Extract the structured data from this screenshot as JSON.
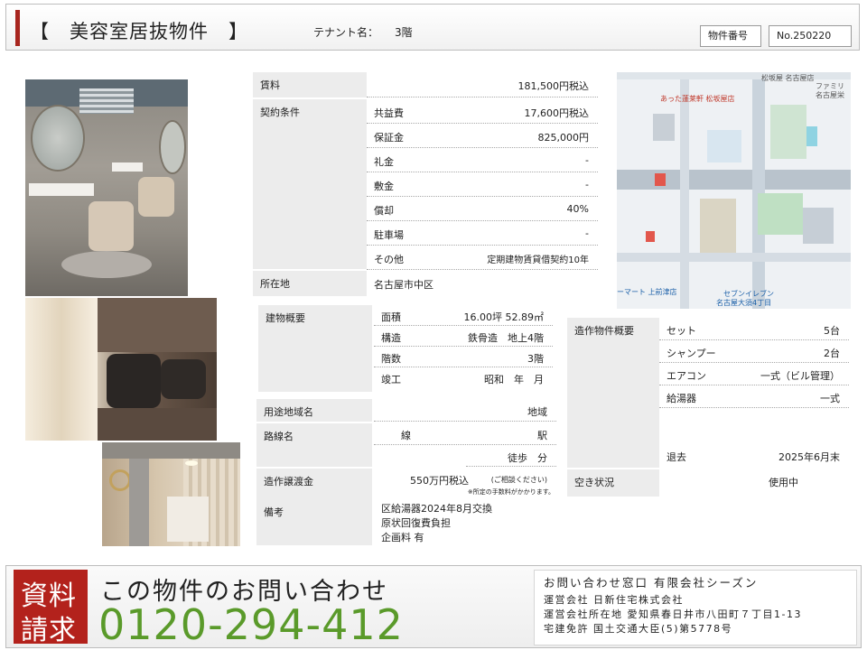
{
  "header": {
    "title": "【　美容室居抜物件　】",
    "tenant_label": "テナント名：",
    "tenant_value": "3階",
    "property_no_label": "物件番号",
    "property_no_value": "No.250220"
  },
  "rent_table": {
    "rent_label": "賃料",
    "rent_value": "181,500円税込",
    "contract_label": "契約条件",
    "contract_rows": [
      {
        "k": "共益費",
        "v": "17,600円税込"
      },
      {
        "k": "保証金",
        "v": "825,000円"
      },
      {
        "k": "礼金",
        "v": "-"
      },
      {
        "k": "敷金",
        "v": "-"
      },
      {
        "k": "償却",
        "v": "40%"
      },
      {
        "k": "駐車場",
        "v": "-"
      },
      {
        "k": "その他",
        "v": "定期建物賃貸借契約10年"
      }
    ],
    "location_label": "所在地",
    "location_value": "名古屋市中区"
  },
  "building": {
    "label": "建物概要",
    "rows": [
      {
        "k": "面積",
        "v": "16.00坪 52.89㎡"
      },
      {
        "k": "構造",
        "v": "鉄骨造　地上4階"
      },
      {
        "k": "階数",
        "v": "3階"
      },
      {
        "k": "竣工",
        "v": "昭和　年　月"
      }
    ]
  },
  "zoning": {
    "label": "用途地域名",
    "value": "地域"
  },
  "route": {
    "label": "路線名",
    "line": "線",
    "station": "駅",
    "walk": "徒歩　分"
  },
  "transfer_fee": {
    "label": "造作譲渡金",
    "value": "550万円税込",
    "note1": "(ご相談ください)",
    "note2": "※所定の手数料がかかります。"
  },
  "remarks": {
    "label": "備考",
    "lines": [
      "区給湯器2024年8月交換",
      "原状回復費負担",
      "企画料 有"
    ]
  },
  "fixtures": {
    "label": "造作物件概要",
    "rows": [
      {
        "k": "セット",
        "v": "5台"
      },
      {
        "k": "シャンプー",
        "v": "2台"
      },
      {
        "k": "エアコン",
        "v": "一式（ビル管理）"
      },
      {
        "k": "給湯器",
        "v": "一式"
      }
    ],
    "leave_label": "退去",
    "leave_value": "2025年6月末",
    "vacancy_label": "空き状況",
    "vacancy_value": "使用中"
  },
  "map": {
    "labels": [
      "松坂屋 名古屋店",
      "ファミリー",
      "名古屋栄",
      "あった蓬莱軒 松坂屋店",
      "ーマート 上前津店",
      "セブンイレブン",
      "名古屋大須4丁目"
    ]
  },
  "footer": {
    "request_line1": "資料",
    "request_line2": "請求",
    "inquiry_title": "この物件のお問い合わせ",
    "phone": "0120-294-412",
    "company_lines": [
      "お問い合わせ窓口 有限会社シーズン",
      "運営会社 日新住宅株式会社",
      "運営会社所在地 愛知県春日井市八田町７丁目1-13",
      "宅建免許 国土交通大臣(5)第5778号"
    ]
  },
  "colors": {
    "accent": "#a8261f",
    "phone_green": "#5a9a2a",
    "label_gray": "#ececec"
  }
}
